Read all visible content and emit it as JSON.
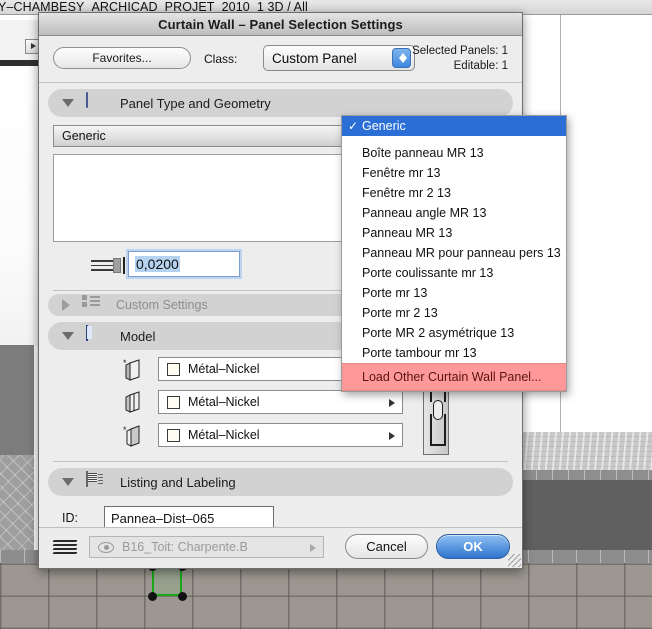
{
  "viewport": {
    "title": "Y–CHAMBESY_ARCHICAD_PROJET_2010_1 3D / All"
  },
  "dialog": {
    "title": "Curtain Wall – Panel Selection Settings",
    "favorites_button": "Favorites...",
    "class_label": "Class:",
    "class_value": "Custom Panel",
    "selected_panels": "Selected Panels: 1",
    "editable": "Editable: 1",
    "sections": {
      "panel_type": {
        "label": "Panel Type and Geometry",
        "expanded": true
      },
      "custom_settings": {
        "label": "Custom Settings",
        "expanded": false
      },
      "model": {
        "label": "Model",
        "expanded": true
      },
      "listing": {
        "label": "Listing and Labeling",
        "expanded": true
      }
    },
    "panel_type_value": "Generic",
    "thickness_value": "0,0200",
    "materials": [
      {
        "name": "Métal–Nickel"
      },
      {
        "name": "Métal–Nickel"
      },
      {
        "name": "Métal–Nickel"
      }
    ],
    "id_label": "ID:",
    "id_value": "Pannea–Dist–065",
    "layer_value": "B16_Toit: Charpente.B",
    "cancel_button": "Cancel",
    "ok_button": "OK"
  },
  "menu": {
    "checkmark": "✓",
    "selected": "Generic",
    "items": [
      "Boîte panneau MR 13",
      "Fenêtre mr 13",
      "Fenêtre mr 2 13",
      "Panneau angle MR 13",
      "Panneau MR 13",
      "Panneau MR pour panneau pers 13",
      "Porte coulissante mr 13",
      "Porte mr 13",
      "Porte mr 2 13",
      "Porte MR 2 asymétrique 13",
      "Porte tambour mr 13"
    ],
    "load_item": "Load Other Curtain Wall Panel..."
  },
  "colors": {
    "menu_highlight": "#2b6fd6",
    "load_highlight": "#ff9999",
    "ok_button": "#2f74cf",
    "selection_green": "#19a819"
  }
}
